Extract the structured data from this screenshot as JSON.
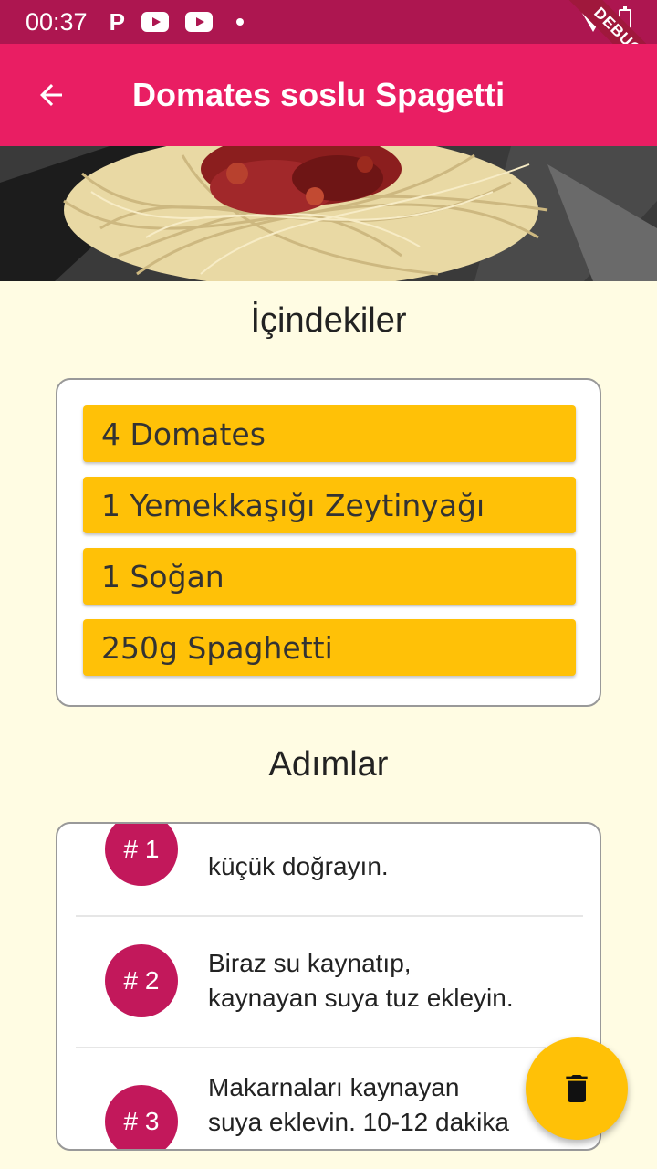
{
  "status_bar": {
    "time": "00:37",
    "icons": [
      "p-icon",
      "youtube-icon",
      "youtube-icon",
      "dot-icon",
      "wifi-icon",
      "battery-icon"
    ],
    "debug_banner": "DEBUG"
  },
  "app_bar": {
    "back_icon": "arrow-back-icon",
    "title": "Domates soslu Spagetti",
    "color": "#E91E63"
  },
  "ingredients": {
    "title": "İçindekiler",
    "items": [
      "4 Domates",
      "1 Yemekkaşığı Zeytinyağı",
      "1 Soğan",
      "250g Spaghetti"
    ],
    "item_color": "#FFC107"
  },
  "steps": {
    "title": "Adımlar",
    "items": [
      {
        "badge": "# 1",
        "text": "küçük doğrayın."
      },
      {
        "badge": "# 2",
        "text": "Biraz su kaynatıp,\nkaynayan suya tuz ekleyin."
      },
      {
        "badge": "# 3",
        "text": "Makarnaları kaynayan\nsuya eklevin. 10-12 dakika"
      }
    ],
    "badge_color": "#C2185B"
  },
  "fab": {
    "icon": "trash-icon",
    "color": "#FFC107"
  }
}
